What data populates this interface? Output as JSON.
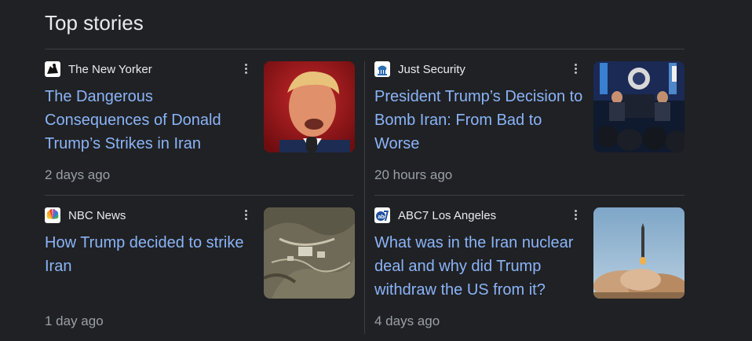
{
  "header": {
    "title": "Top stories"
  },
  "stories": [
    {
      "source": "The New Yorker",
      "favicon": "new-yorker-icon",
      "title": "The Dangerous Consequences of Donald Trump’s Strikes in Iran",
      "time": "2 days ago",
      "thumbnail": "trump-speaking-photo"
    },
    {
      "source": "Just Security",
      "favicon": "just-security-icon",
      "title": "President Trump’s Decision to Bomb Iran: From Bad to Worse",
      "time": "20 hours ago",
      "thumbnail": "press-briefing-photo"
    },
    {
      "source": "NBC News",
      "favicon": "nbc-peacock-icon",
      "title": "How Trump decided to strike Iran",
      "time": "1 day ago",
      "thumbnail": "satellite-image-photo"
    },
    {
      "source": "ABC7 Los Angeles",
      "favicon": "abc7-icon",
      "title": "What was in the Iran nuclear deal and why did Trump withdraw the US from it?",
      "time": "4 days ago",
      "thumbnail": "missile-launch-photo"
    }
  ],
  "colors": {
    "background": "#202124",
    "link": "#8ab4f8",
    "muted": "#9aa0a6",
    "divider": "#3c4043"
  }
}
